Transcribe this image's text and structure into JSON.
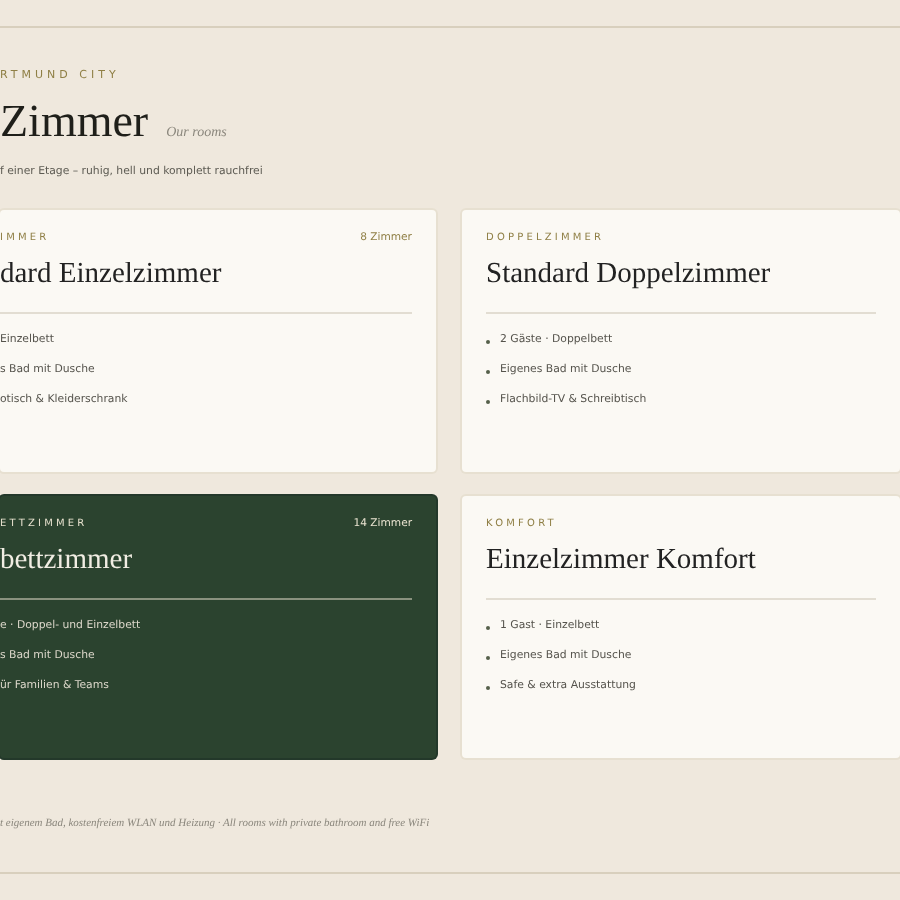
{
  "header": {
    "eyebrow": "RTMUND CITY",
    "title": "Zimmer",
    "subtitle": "Our rooms",
    "intro": "f einer Etage – ruhig, hell und komplett rauchfrei"
  },
  "rooms": [
    {
      "kind": "light",
      "category": "IMMER",
      "name": "dard Einzelzimmer",
      "count": "8 Zimmer",
      "bullets": false,
      "features": [
        "Einzelbett",
        "s Bad mit Dusche",
        "otisch & Kleiderschrank"
      ]
    },
    {
      "kind": "light",
      "category": "DOPPELZIMMER",
      "name": "Standard Doppelzimmer",
      "bullets": true,
      "features": [
        "2 Gäste · Doppelbett",
        "Eigenes Bad mit Dusche",
        "Flachbild-TV & Schreibtisch"
      ]
    },
    {
      "kind": "dark",
      "category": "ETTZIMMER",
      "name": "bettzimmer",
      "count": "14 Zimmer",
      "bullets": false,
      "features": [
        "e · Doppel- und Einzelbett",
        "s Bad mit Dusche",
        "ür Familien & Teams"
      ]
    },
    {
      "kind": "light",
      "category": "KOMFORT",
      "name": "Einzelzimmer Komfort",
      "bullets": true,
      "features": [
        "1 Gast · Einzelbett",
        "Eigenes Bad mit Dusche",
        "Safe & extra Ausstattung"
      ]
    }
  ],
  "footer_note": "t eigenem Bad, kostenfreiem WLAN und Heizung · All rooms with private bathroom and free WiFi"
}
